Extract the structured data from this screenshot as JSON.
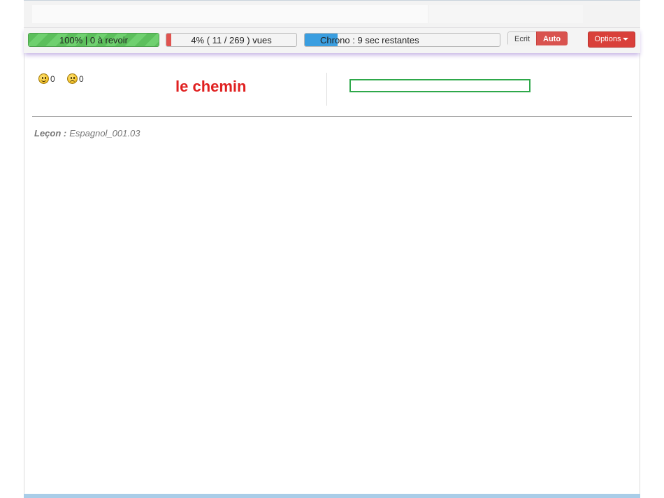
{
  "progress": {
    "review": {
      "label": "100%  |  0 à revoir",
      "percent": 100
    },
    "seen": {
      "label": "4% ( 11 / 269 ) vues",
      "percent": 4
    },
    "timer": {
      "label": "Chrono : 9 sec restantes",
      "percent": 17
    }
  },
  "mode": {
    "ecrit_label": "Ecrit",
    "auto_label": "Auto",
    "active": "Auto"
  },
  "options_label": "Options",
  "scores": {
    "correct": "0",
    "wrong": "0"
  },
  "word": "le chemin",
  "answer": {
    "value": ""
  },
  "lesson": {
    "label": "Leçon :",
    "name": "Espagnol_001.03"
  },
  "colors": {
    "accent_red": "#e02020",
    "review_green": "#5cbf5c",
    "timer_blue": "#3a9ee0",
    "input_border": "#2ea84a"
  }
}
